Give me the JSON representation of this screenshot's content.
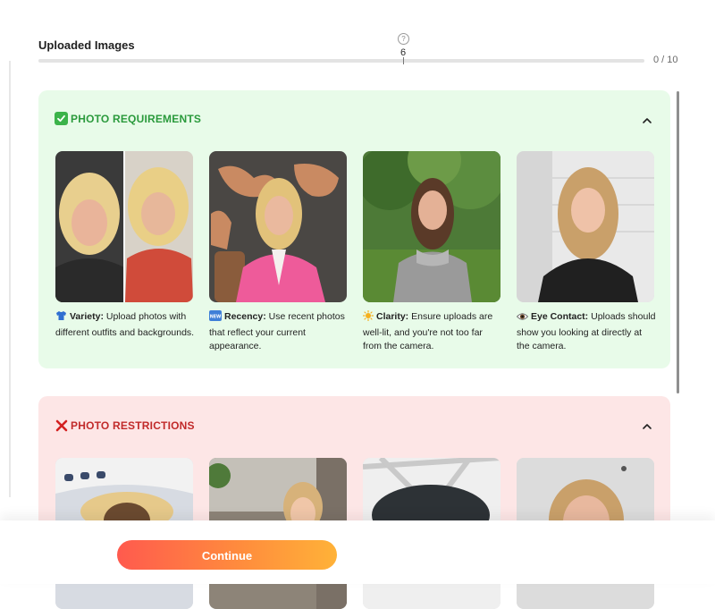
{
  "uploaded": {
    "title": "Uploaded Images",
    "help": "?",
    "progress_value": "6",
    "progress_fraction": 0.6,
    "count": "0 / 10"
  },
  "requirements": {
    "title": "PHOTO REQUIREMENTS",
    "accent": "#2a9a3c",
    "background": "#e8fbe9",
    "items": [
      {
        "icon": "tshirt-icon",
        "title": "Variety:",
        "text": "Upload photos with different outfits and backgrounds."
      },
      {
        "icon": "new-badge-icon",
        "title": "Recency:",
        "text": "Use recent photos that reflect your current appearance."
      },
      {
        "icon": "sun-icon",
        "title": "Clarity:",
        "text": "Ensure uploads are well-lit, and you're not too far from the camera."
      },
      {
        "icon": "eye-icon",
        "title": "Eye Contact:",
        "text": "Uploads should show you looking at directly at the camera."
      }
    ]
  },
  "restrictions": {
    "title": "PHOTO RESTRICTIONS",
    "accent": "#c12a2a",
    "background": "#fde6e6"
  },
  "footer": {
    "continue_label": "Continue"
  }
}
